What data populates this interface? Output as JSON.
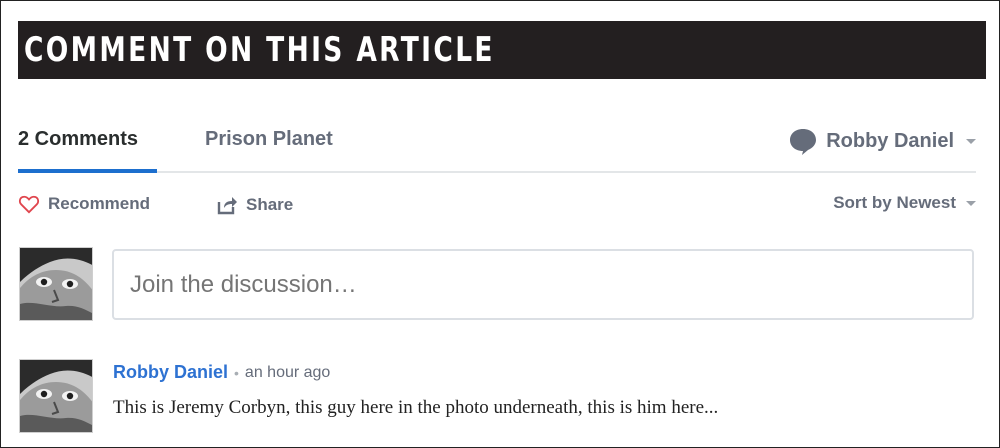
{
  "banner": {
    "title": "COMMENT ON THIS ARTICLE"
  },
  "nav": {
    "comments_tab": "2 Comments",
    "site_tab": "Prison Planet",
    "user_name": "Robby Daniel"
  },
  "actions": {
    "recommend": "Recommend",
    "share": "Share",
    "sort": "Sort by Newest"
  },
  "composer": {
    "placeholder": "Join the discussion…"
  },
  "comments": [
    {
      "author": "Robby Daniel",
      "separator": "•",
      "time": "an hour ago",
      "body": "This is Jeremy Corbyn, this guy here in the photo underneath, this is him here..."
    }
  ],
  "icons": {
    "recommend": "heart-icon",
    "share": "share-icon",
    "user": "chat-bubble-icon",
    "sort_caret": "chevron-down-icon"
  },
  "colors": {
    "banner_bg": "#231f20",
    "tab_underline": "#1d6fce",
    "author_link": "#2e72d2",
    "heart": "#e0464e"
  }
}
